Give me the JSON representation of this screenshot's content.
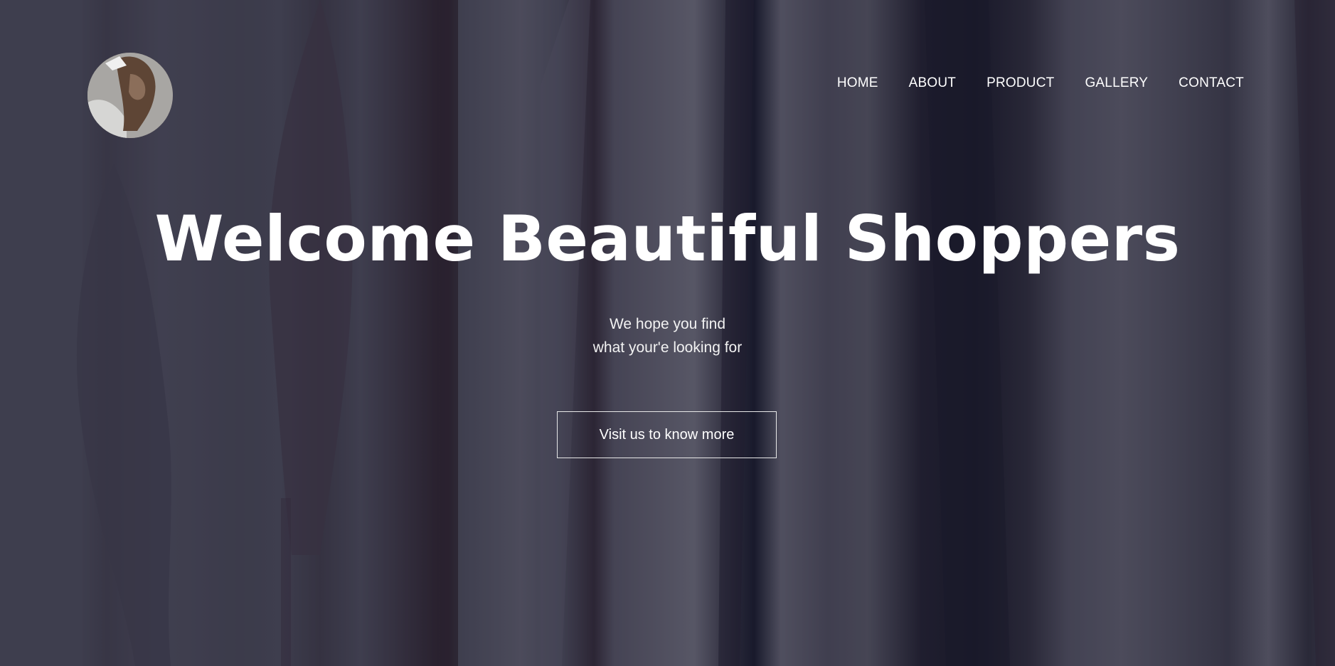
{
  "header": {
    "logo_alt": "logo",
    "nav": [
      {
        "label": "HOME"
      },
      {
        "label": "ABOUT"
      },
      {
        "label": "PRODUCT"
      },
      {
        "label": "GALLERY"
      },
      {
        "label": "CONTACT"
      }
    ]
  },
  "hero": {
    "title": "Welcome Beautiful Shoppers",
    "subtitle_line1": "We hope you find",
    "subtitle_line2": "what your'e looking for",
    "cta_label": "Visit us to know more"
  },
  "colors": {
    "text": "#ffffff",
    "background": "#474756"
  }
}
